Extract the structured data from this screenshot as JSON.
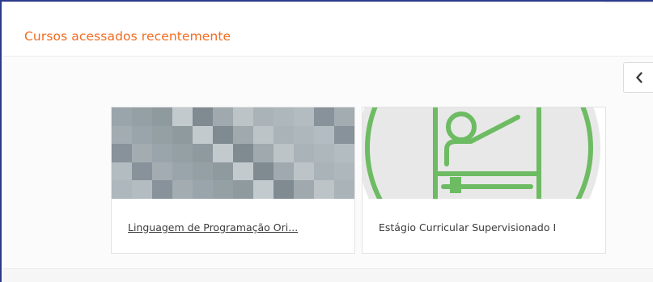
{
  "block": {
    "title": "Cursos acessados recentemente"
  },
  "navigation": {
    "prev_icon": "chevron-left-icon"
  },
  "courses": [
    {
      "name": "Linguagem de Programação Ori...",
      "image": "pixelated-course-image"
    },
    {
      "name": "Estágio Curricular Supervisionado I",
      "image": "teacher-at-board-icon"
    }
  ],
  "colors": {
    "title": "#f36b21",
    "accent_green": "#6dbb63",
    "image_bg": "#e9e8e8"
  }
}
